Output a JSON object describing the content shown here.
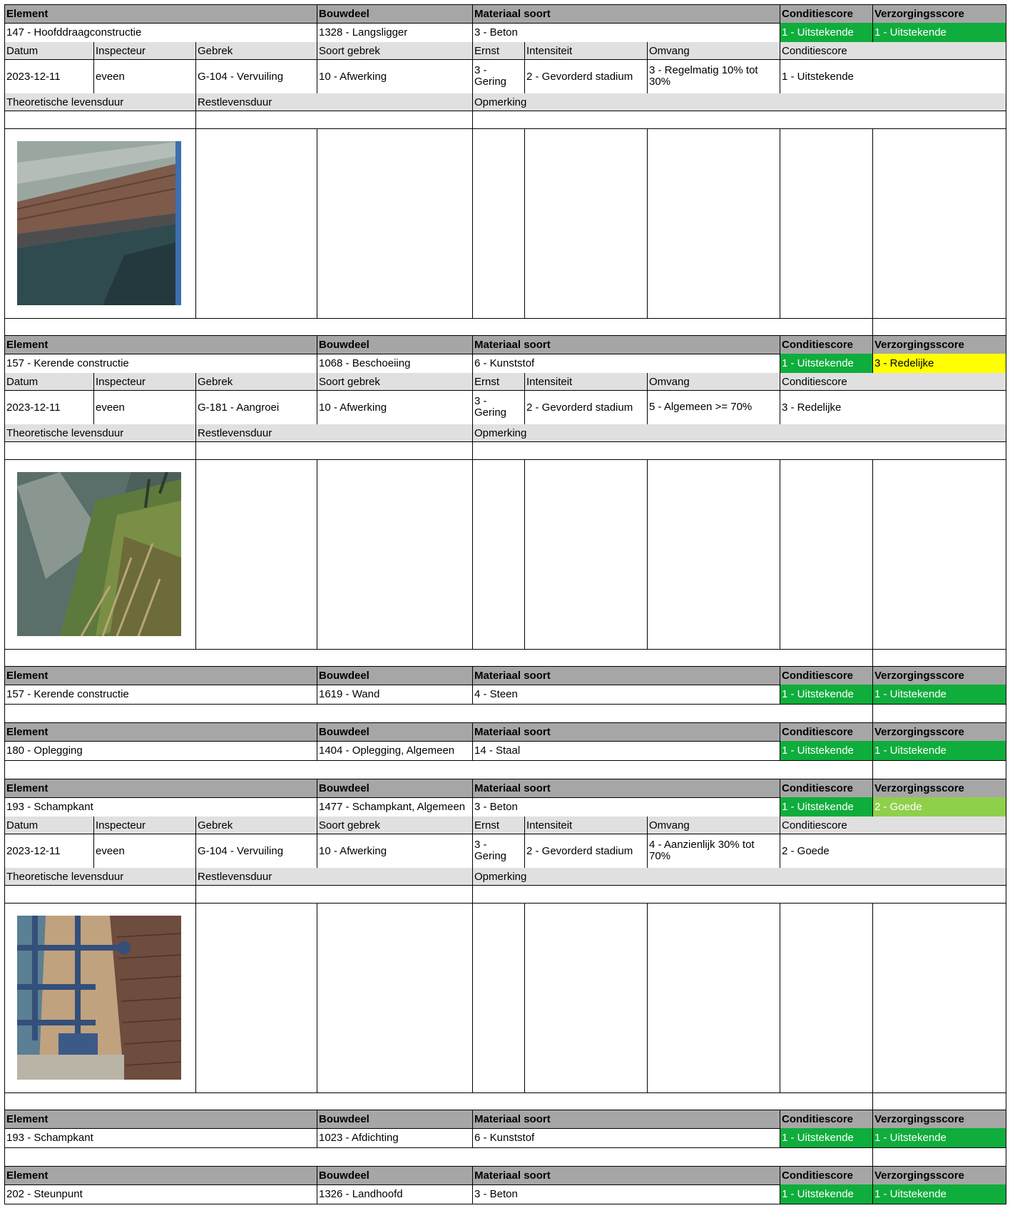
{
  "headers": {
    "element": "Element",
    "bouwdeel": "Bouwdeel",
    "materiaal": "Materiaal soort",
    "conditiescore": "Conditiescore",
    "verzorgingsscore": "Verzorgingsscore"
  },
  "inspection_headers": {
    "datum": "Datum",
    "inspecteur": "Inspecteur",
    "gebrek": "Gebrek",
    "soort_gebrek": "Soort gebrek",
    "ernst": "Ernst",
    "intensiteit": "Intensiteit",
    "omvang": "Omvang",
    "conditiescore": "Conditiescore"
  },
  "life_headers": {
    "theoretisch": "Theoretische levensduur",
    "rest": "Restlevensduur",
    "opmerking": "Opmerking"
  },
  "colors": {
    "header_gray": "#a6a6a6",
    "subheader_gray": "#e0e0e0",
    "score_green": "#0fad3c",
    "score_lightgreen": "#8fd04a",
    "score_yellow": "#ffff00"
  },
  "blocks": [
    {
      "element": "147 - Hoofddraagconstructie",
      "bouwdeel": "1328 - Langsligger",
      "materiaal": "3 - Beton",
      "conditiescore": "1 - Uitstekende",
      "verzorgingsscore": "1 - Uitstekende",
      "inspection": {
        "datum": "2023-12-11",
        "inspecteur": "eveen",
        "gebrek": "G-104 - Vervuiling",
        "soort_gebrek": "10 - Afwerking",
        "ernst": "3 - Gering",
        "intensiteit": "2 - Gevorderd stadium",
        "omvang": "3 - Regelmatig 10% tot 30%",
        "conditiescore": "1 - Uitstekende"
      },
      "photo": "beam-over-water-photo"
    },
    {
      "element": "157 - Kerende constructie",
      "bouwdeel": "1068 - Beschoeiing",
      "materiaal": "6 - Kunststof",
      "conditiescore": "1 - Uitstekende",
      "verzorgingsscore": "3 - Redelijke",
      "inspection": {
        "datum": "2023-12-11",
        "inspecteur": "eveen",
        "gebrek": "G-181 - Aangroei",
        "soort_gebrek": "10 - Afwerking",
        "ernst": "3 - Gering",
        "intensiteit": "2 - Gevorderd stadium",
        "omvang": "5 - Algemeen >= 70%",
        "conditiescore": "3 - Redelijke"
      },
      "photo": "overgrown-bank-photo"
    },
    {
      "element": "157 - Kerende constructie",
      "bouwdeel": "1619 - Wand",
      "materiaal": "4 - Steen",
      "conditiescore": "1 - Uitstekende",
      "verzorgingsscore": "1 - Uitstekende"
    },
    {
      "element": "180 - Oplegging",
      "bouwdeel": "1404 - Oplegging, Algemeen",
      "materiaal": "14 - Staal",
      "conditiescore": "1 - Uitstekende",
      "verzorgingsscore": "1 - Uitstekende"
    },
    {
      "element": "193 - Schampkant",
      "bouwdeel": "1477 - Schampkant, Algemeen",
      "materiaal": "3 - Beton",
      "conditiescore": "1 - Uitstekende",
      "verzorgingsscore": "2 - Goede",
      "inspection": {
        "datum": "2023-12-11",
        "inspecteur": "eveen",
        "gebrek": "G-104 - Vervuiling",
        "soort_gebrek": "10 - Afwerking",
        "ernst": "3 - Gering",
        "intensiteit": "2 - Gevorderd stadium",
        "omvang": "4 - Aanzienlijk 30% tot 70%",
        "conditiescore": "2 - Goede"
      },
      "photo": "railing-brick-wall-photo"
    },
    {
      "element": "193 - Schampkant",
      "bouwdeel": "1023 - Afdichting",
      "materiaal": "6 - Kunststof",
      "conditiescore": "1 - Uitstekende",
      "verzorgingsscore": "1 - Uitstekende"
    },
    {
      "element": "202 - Steunpunt",
      "bouwdeel": "1326 - Landhoofd",
      "materiaal": "3 - Beton",
      "conditiescore": "1 - Uitstekende",
      "verzorgingsscore": "1 - Uitstekende"
    }
  ]
}
